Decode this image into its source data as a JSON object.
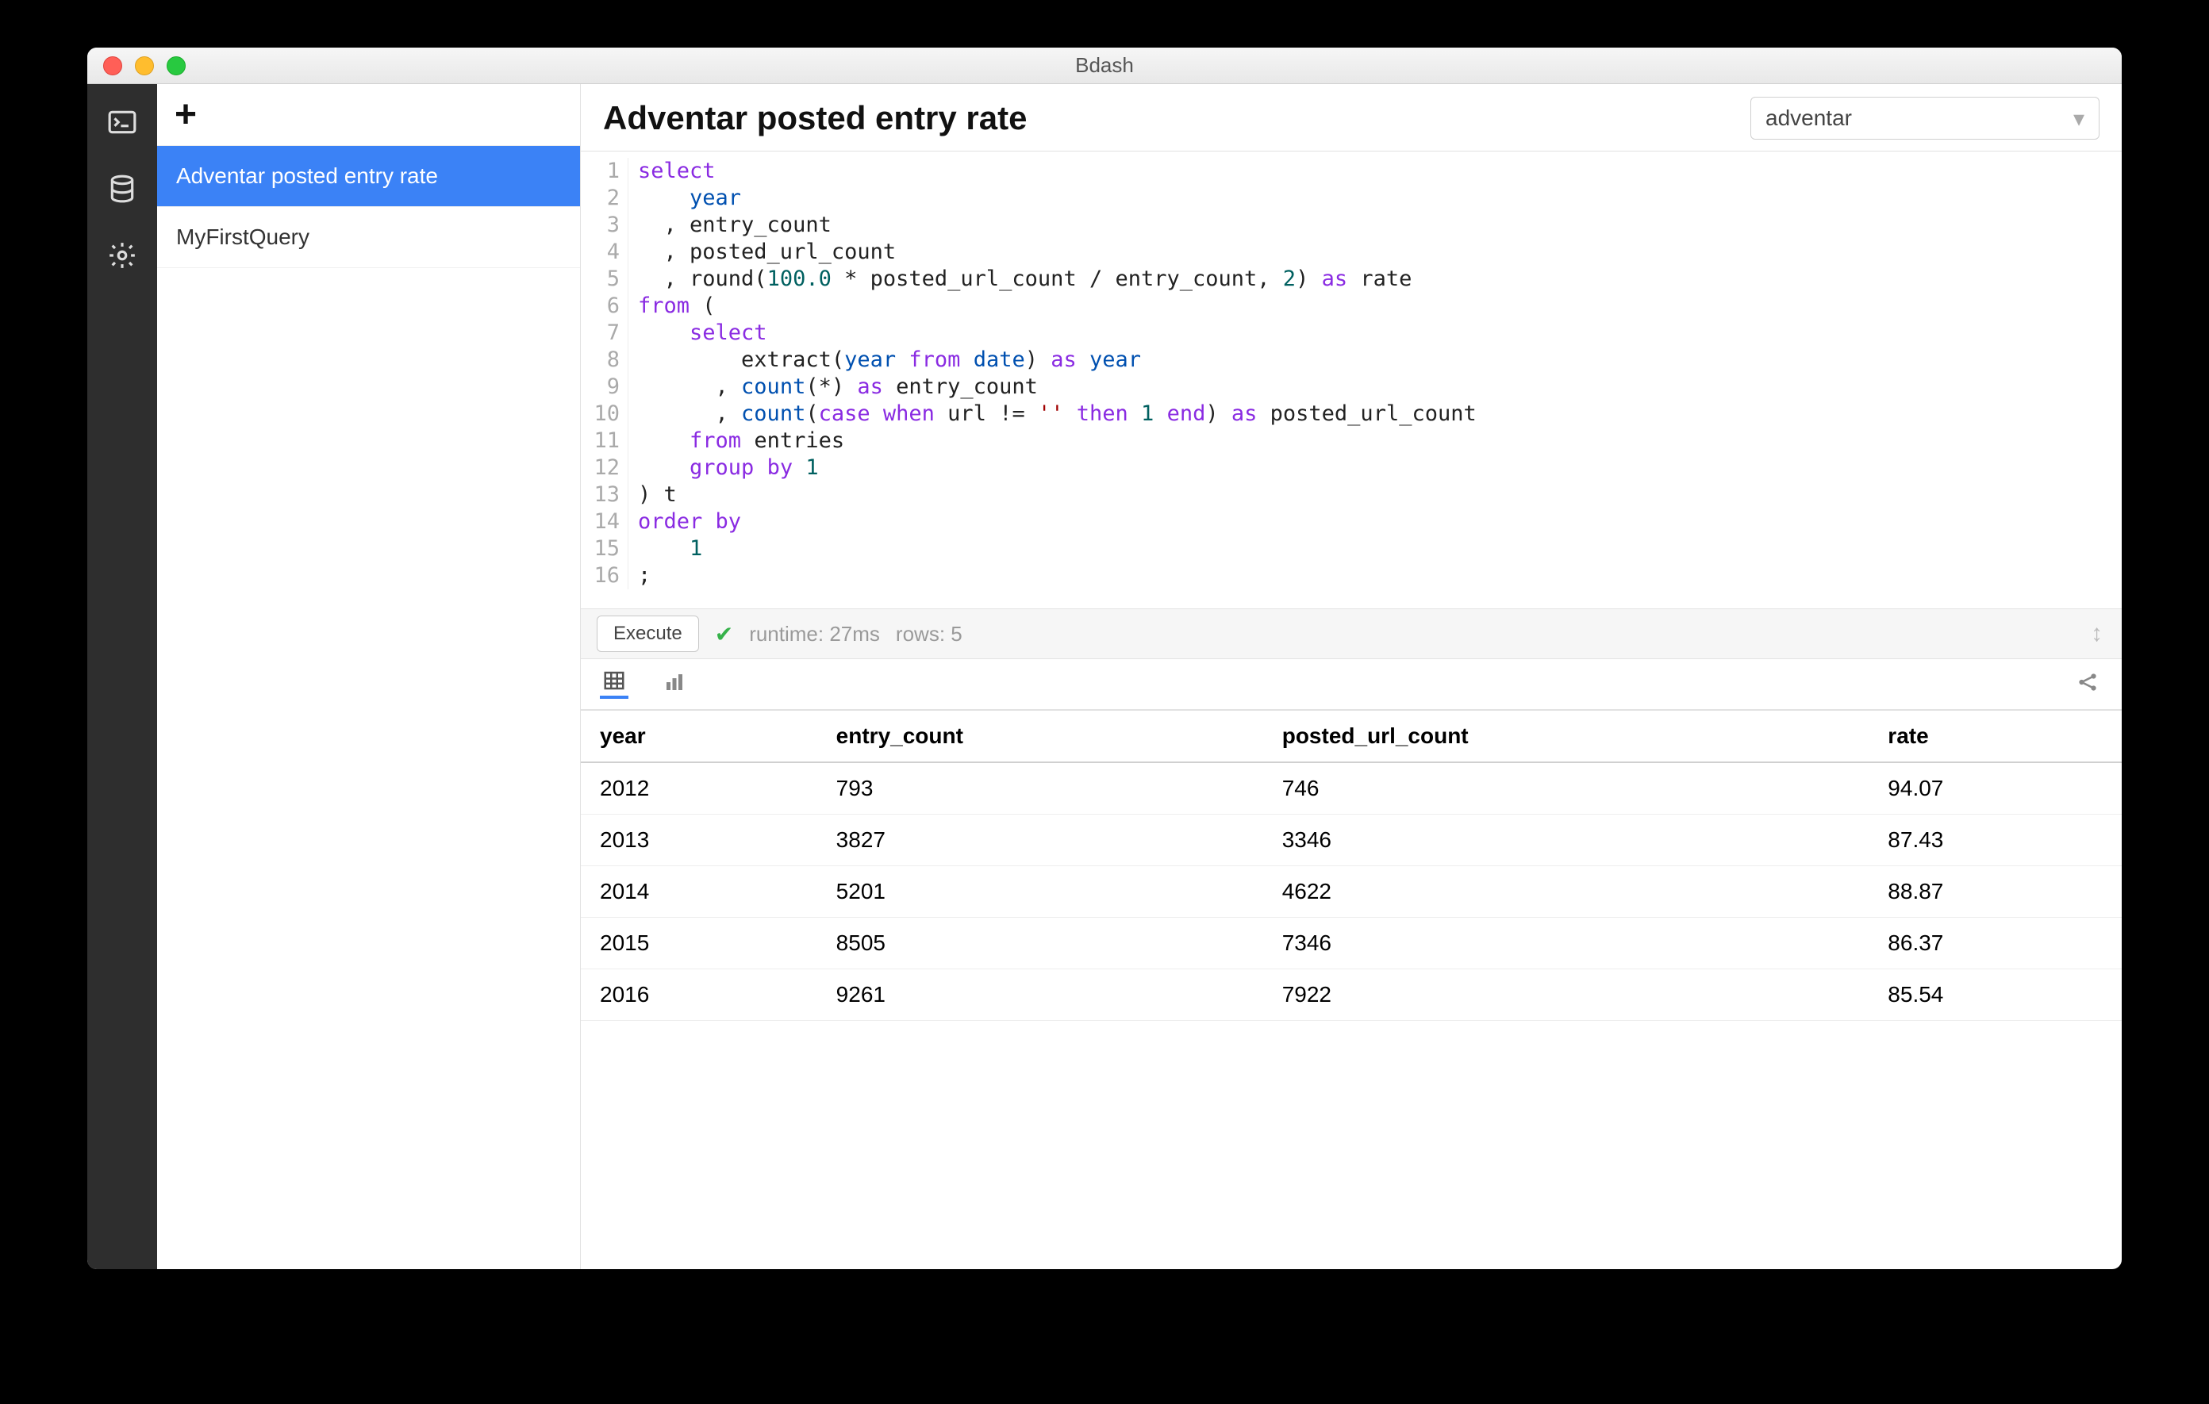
{
  "window": {
    "title": "Bdash"
  },
  "sidebar": {
    "items": [
      {
        "label": "Adventar posted entry rate",
        "active": true
      },
      {
        "label": "MyFirstQuery",
        "active": false
      }
    ]
  },
  "main": {
    "title": "Adventar posted entry rate",
    "datasource": "adventar"
  },
  "editor": {
    "line_count": 16,
    "sql_tokens": [
      [
        {
          "t": "select",
          "c": "kw"
        }
      ],
      [
        {
          "t": "    year",
          "c": "ident"
        }
      ],
      [
        {
          "t": "  , entry_count",
          "c": ""
        }
      ],
      [
        {
          "t": "  , posted_url_count",
          "c": ""
        }
      ],
      [
        {
          "t": "  , round(",
          "c": ""
        },
        {
          "t": "100.0",
          "c": "num"
        },
        {
          "t": " * posted_url_count / entry_count, ",
          "c": ""
        },
        {
          "t": "2",
          "c": "num"
        },
        {
          "t": ") ",
          "c": ""
        },
        {
          "t": "as",
          "c": "kw"
        },
        {
          "t": " rate",
          "c": ""
        }
      ],
      [
        {
          "t": "from",
          "c": "kw"
        },
        {
          "t": " (",
          "c": ""
        }
      ],
      [
        {
          "t": "    ",
          "c": ""
        },
        {
          "t": "select",
          "c": "kw"
        }
      ],
      [
        {
          "t": "        extract(",
          "c": ""
        },
        {
          "t": "year",
          "c": "ident"
        },
        {
          "t": " ",
          "c": ""
        },
        {
          "t": "from",
          "c": "kw"
        },
        {
          "t": " ",
          "c": ""
        },
        {
          "t": "date",
          "c": "ident"
        },
        {
          "t": ") ",
          "c": ""
        },
        {
          "t": "as",
          "c": "kw"
        },
        {
          "t": " ",
          "c": ""
        },
        {
          "t": "year",
          "c": "ident"
        }
      ],
      [
        {
          "t": "      , ",
          "c": ""
        },
        {
          "t": "count",
          "c": "ident"
        },
        {
          "t": "(*) ",
          "c": ""
        },
        {
          "t": "as",
          "c": "kw"
        },
        {
          "t": " entry_count",
          "c": ""
        }
      ],
      [
        {
          "t": "      , ",
          "c": ""
        },
        {
          "t": "count",
          "c": "ident"
        },
        {
          "t": "(",
          "c": ""
        },
        {
          "t": "case",
          "c": "kw"
        },
        {
          "t": " ",
          "c": ""
        },
        {
          "t": "when",
          "c": "kw"
        },
        {
          "t": " url != ",
          "c": ""
        },
        {
          "t": "''",
          "c": "str"
        },
        {
          "t": " ",
          "c": ""
        },
        {
          "t": "then",
          "c": "kw"
        },
        {
          "t": " ",
          "c": ""
        },
        {
          "t": "1",
          "c": "num"
        },
        {
          "t": " ",
          "c": ""
        },
        {
          "t": "end",
          "c": "kw"
        },
        {
          "t": ") ",
          "c": ""
        },
        {
          "t": "as",
          "c": "kw"
        },
        {
          "t": " posted_url_count",
          "c": ""
        }
      ],
      [
        {
          "t": "    ",
          "c": ""
        },
        {
          "t": "from",
          "c": "kw"
        },
        {
          "t": " entries",
          "c": ""
        }
      ],
      [
        {
          "t": "    ",
          "c": ""
        },
        {
          "t": "group by",
          "c": "kw"
        },
        {
          "t": " ",
          "c": ""
        },
        {
          "t": "1",
          "c": "num"
        }
      ],
      [
        {
          "t": ") t",
          "c": ""
        }
      ],
      [
        {
          "t": "order by",
          "c": "kw"
        }
      ],
      [
        {
          "t": "    ",
          "c": ""
        },
        {
          "t": "1",
          "c": "num"
        }
      ],
      [
        {
          "t": ";",
          "c": ""
        }
      ]
    ]
  },
  "exec": {
    "button": "Execute",
    "status_runtime": "runtime: 27ms",
    "status_rows": "rows: 5"
  },
  "results": {
    "columns": [
      "year",
      "entry_count",
      "posted_url_count",
      "rate"
    ],
    "rows": [
      [
        "2012",
        "793",
        "746",
        "94.07"
      ],
      [
        "2013",
        "3827",
        "3346",
        "87.43"
      ],
      [
        "2014",
        "5201",
        "4622",
        "88.87"
      ],
      [
        "2015",
        "8505",
        "7346",
        "86.37"
      ],
      [
        "2016",
        "9261",
        "7922",
        "85.54"
      ]
    ]
  },
  "chart_data": {
    "type": "table",
    "columns": [
      "year",
      "entry_count",
      "posted_url_count",
      "rate"
    ],
    "rows": [
      [
        2012,
        793,
        746,
        94.07
      ],
      [
        2013,
        3827,
        3346,
        87.43
      ],
      [
        2014,
        5201,
        4622,
        88.87
      ],
      [
        2015,
        8505,
        7346,
        86.37
      ],
      [
        2016,
        9261,
        7922,
        85.54
      ]
    ]
  }
}
